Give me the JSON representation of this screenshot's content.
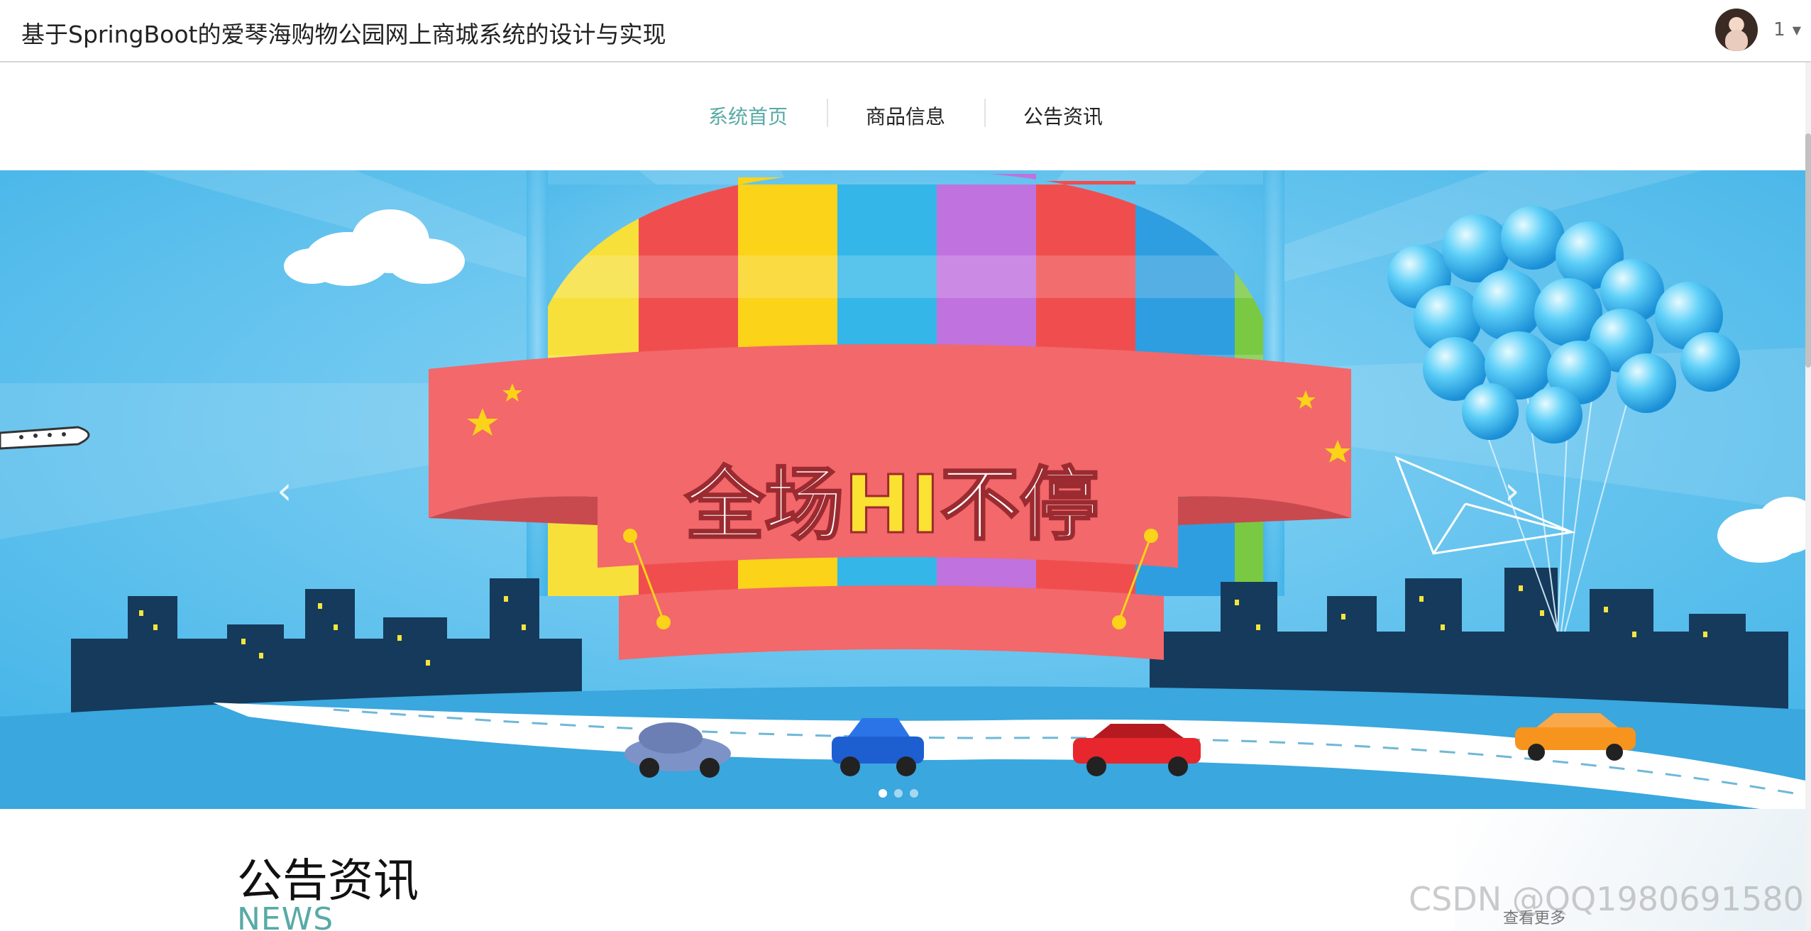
{
  "header": {
    "title": "基于SpringBoot的爱琴海购物公园网上商城系统的设计与实现",
    "username": "1",
    "caret": "▼"
  },
  "nav": {
    "items": [
      {
        "label": "系统首页",
        "active": true
      },
      {
        "label": "商品信息",
        "active": false
      },
      {
        "label": "公告资讯",
        "active": false
      }
    ]
  },
  "banner": {
    "slogan_part1": "全场",
    "slogan_hi": "HI",
    "slogan_part2": "不停",
    "prev_arrow": "‹",
    "next_arrow": "›",
    "dots_count": 3,
    "active_dot": 0
  },
  "notice": {
    "title": "公告资讯",
    "subtitle": "NEWS",
    "more_label": "查看更多"
  },
  "watermark": "CSDN @QQ1980691580",
  "colors": {
    "accent": "#58aaa6",
    "banner_sky": "#5cc3f0",
    "ribbon": "#f2686b",
    "city": "#153a5c"
  }
}
